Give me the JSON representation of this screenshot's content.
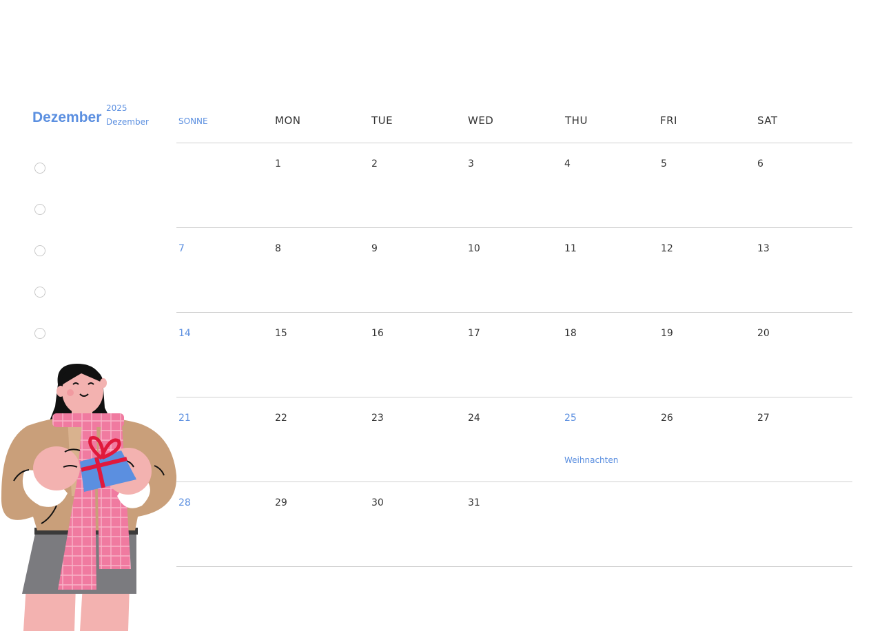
{
  "header": {
    "month": "Dezember",
    "year": "2025",
    "month_sub": "Dezember"
  },
  "todo": {
    "count": 5
  },
  "calendar": {
    "weekdays": [
      "SONNE",
      "MON",
      "TUE",
      "WED",
      "THU",
      "FRI",
      "SAT"
    ],
    "weeks": [
      [
        "",
        "1",
        "2",
        "3",
        "4",
        "5",
        "6"
      ],
      [
        "7",
        "8",
        "9",
        "10",
        "11",
        "12",
        "13"
      ],
      [
        "14",
        "15",
        "16",
        "17",
        "18",
        "19",
        "20"
      ],
      [
        "21",
        "22",
        "23",
        "24",
        "25",
        "26",
        "27"
      ],
      [
        "28",
        "29",
        "30",
        "31",
        "",
        "",
        ""
      ]
    ],
    "highlighted_dates": [
      "25"
    ],
    "holiday": {
      "date": "25",
      "label": "Weihnachten"
    }
  },
  "colors": {
    "accent": "#5b8fe0",
    "text": "#333333",
    "grid_line": "#cfcfcf",
    "checkbox_border": "#c8c8c8"
  },
  "illustration": {
    "icon": "woman-holding-gift-illustration"
  }
}
